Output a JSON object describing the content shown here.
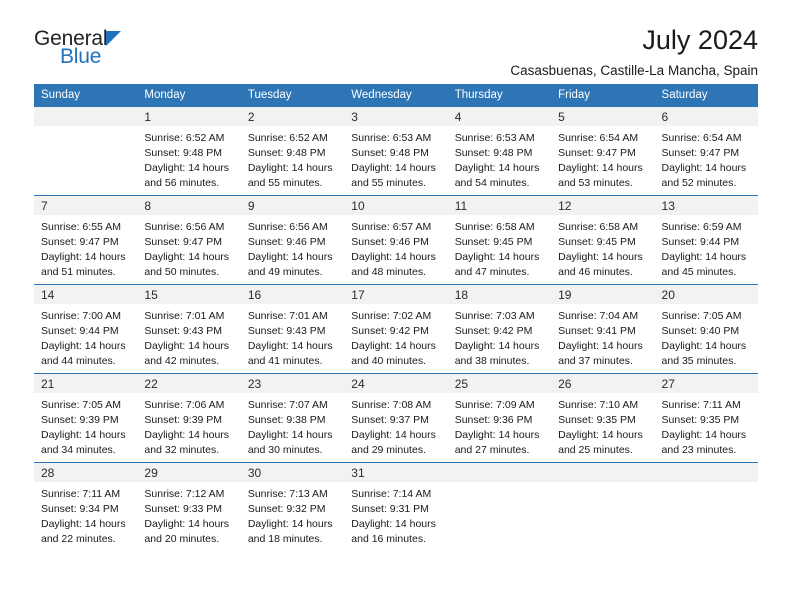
{
  "brand": {
    "name_top": "General",
    "name_bottom": "Blue",
    "accent_color": "#1F72BD",
    "triangle_icon": "brand-triangle-icon"
  },
  "header": {
    "title": "July 2024",
    "subtitle": "Casasbuenas, Castille-La Mancha, Spain"
  },
  "theme": {
    "header_bg": "#2E75B6",
    "daynum_bg": "#F2F2F2",
    "row_border": "#2E75B6"
  },
  "calendar": {
    "weekday_headers": [
      "Sunday",
      "Monday",
      "Tuesday",
      "Wednesday",
      "Thursday",
      "Friday",
      "Saturday"
    ],
    "labels": {
      "sunrise_prefix": "Sunrise:",
      "sunset_prefix": "Sunset:",
      "daylight_prefix": "Daylight:"
    },
    "weeks": [
      [
        {
          "day": ""
        },
        {
          "day": "1",
          "sunrise": "Sunrise: 6:52 AM",
          "sunset": "Sunset: 9:48 PM",
          "daylight_line1": "Daylight: 14 hours",
          "daylight_line2": "and 56 minutes."
        },
        {
          "day": "2",
          "sunrise": "Sunrise: 6:52 AM",
          "sunset": "Sunset: 9:48 PM",
          "daylight_line1": "Daylight: 14 hours",
          "daylight_line2": "and 55 minutes."
        },
        {
          "day": "3",
          "sunrise": "Sunrise: 6:53 AM",
          "sunset": "Sunset: 9:48 PM",
          "daylight_line1": "Daylight: 14 hours",
          "daylight_line2": "and 55 minutes."
        },
        {
          "day": "4",
          "sunrise": "Sunrise: 6:53 AM",
          "sunset": "Sunset: 9:48 PM",
          "daylight_line1": "Daylight: 14 hours",
          "daylight_line2": "and 54 minutes."
        },
        {
          "day": "5",
          "sunrise": "Sunrise: 6:54 AM",
          "sunset": "Sunset: 9:47 PM",
          "daylight_line1": "Daylight: 14 hours",
          "daylight_line2": "and 53 minutes."
        },
        {
          "day": "6",
          "sunrise": "Sunrise: 6:54 AM",
          "sunset": "Sunset: 9:47 PM",
          "daylight_line1": "Daylight: 14 hours",
          "daylight_line2": "and 52 minutes."
        }
      ],
      [
        {
          "day": "7",
          "sunrise": "Sunrise: 6:55 AM",
          "sunset": "Sunset: 9:47 PM",
          "daylight_line1": "Daylight: 14 hours",
          "daylight_line2": "and 51 minutes."
        },
        {
          "day": "8",
          "sunrise": "Sunrise: 6:56 AM",
          "sunset": "Sunset: 9:47 PM",
          "daylight_line1": "Daylight: 14 hours",
          "daylight_line2": "and 50 minutes."
        },
        {
          "day": "9",
          "sunrise": "Sunrise: 6:56 AM",
          "sunset": "Sunset: 9:46 PM",
          "daylight_line1": "Daylight: 14 hours",
          "daylight_line2": "and 49 minutes."
        },
        {
          "day": "10",
          "sunrise": "Sunrise: 6:57 AM",
          "sunset": "Sunset: 9:46 PM",
          "daylight_line1": "Daylight: 14 hours",
          "daylight_line2": "and 48 minutes."
        },
        {
          "day": "11",
          "sunrise": "Sunrise: 6:58 AM",
          "sunset": "Sunset: 9:45 PM",
          "daylight_line1": "Daylight: 14 hours",
          "daylight_line2": "and 47 minutes."
        },
        {
          "day": "12",
          "sunrise": "Sunrise: 6:58 AM",
          "sunset": "Sunset: 9:45 PM",
          "daylight_line1": "Daylight: 14 hours",
          "daylight_line2": "and 46 minutes."
        },
        {
          "day": "13",
          "sunrise": "Sunrise: 6:59 AM",
          "sunset": "Sunset: 9:44 PM",
          "daylight_line1": "Daylight: 14 hours",
          "daylight_line2": "and 45 minutes."
        }
      ],
      [
        {
          "day": "14",
          "sunrise": "Sunrise: 7:00 AM",
          "sunset": "Sunset: 9:44 PM",
          "daylight_line1": "Daylight: 14 hours",
          "daylight_line2": "and 44 minutes."
        },
        {
          "day": "15",
          "sunrise": "Sunrise: 7:01 AM",
          "sunset": "Sunset: 9:43 PM",
          "daylight_line1": "Daylight: 14 hours",
          "daylight_line2": "and 42 minutes."
        },
        {
          "day": "16",
          "sunrise": "Sunrise: 7:01 AM",
          "sunset": "Sunset: 9:43 PM",
          "daylight_line1": "Daylight: 14 hours",
          "daylight_line2": "and 41 minutes."
        },
        {
          "day": "17",
          "sunrise": "Sunrise: 7:02 AM",
          "sunset": "Sunset: 9:42 PM",
          "daylight_line1": "Daylight: 14 hours",
          "daylight_line2": "and 40 minutes."
        },
        {
          "day": "18",
          "sunrise": "Sunrise: 7:03 AM",
          "sunset": "Sunset: 9:42 PM",
          "daylight_line1": "Daylight: 14 hours",
          "daylight_line2": "and 38 minutes."
        },
        {
          "day": "19",
          "sunrise": "Sunrise: 7:04 AM",
          "sunset": "Sunset: 9:41 PM",
          "daylight_line1": "Daylight: 14 hours",
          "daylight_line2": "and 37 minutes."
        },
        {
          "day": "20",
          "sunrise": "Sunrise: 7:05 AM",
          "sunset": "Sunset: 9:40 PM",
          "daylight_line1": "Daylight: 14 hours",
          "daylight_line2": "and 35 minutes."
        }
      ],
      [
        {
          "day": "21",
          "sunrise": "Sunrise: 7:05 AM",
          "sunset": "Sunset: 9:39 PM",
          "daylight_line1": "Daylight: 14 hours",
          "daylight_line2": "and 34 minutes."
        },
        {
          "day": "22",
          "sunrise": "Sunrise: 7:06 AM",
          "sunset": "Sunset: 9:39 PM",
          "daylight_line1": "Daylight: 14 hours",
          "daylight_line2": "and 32 minutes."
        },
        {
          "day": "23",
          "sunrise": "Sunrise: 7:07 AM",
          "sunset": "Sunset: 9:38 PM",
          "daylight_line1": "Daylight: 14 hours",
          "daylight_line2": "and 30 minutes."
        },
        {
          "day": "24",
          "sunrise": "Sunrise: 7:08 AM",
          "sunset": "Sunset: 9:37 PM",
          "daylight_line1": "Daylight: 14 hours",
          "daylight_line2": "and 29 minutes."
        },
        {
          "day": "25",
          "sunrise": "Sunrise: 7:09 AM",
          "sunset": "Sunset: 9:36 PM",
          "daylight_line1": "Daylight: 14 hours",
          "daylight_line2": "and 27 minutes."
        },
        {
          "day": "26",
          "sunrise": "Sunrise: 7:10 AM",
          "sunset": "Sunset: 9:35 PM",
          "daylight_line1": "Daylight: 14 hours",
          "daylight_line2": "and 25 minutes."
        },
        {
          "day": "27",
          "sunrise": "Sunrise: 7:11 AM",
          "sunset": "Sunset: 9:35 PM",
          "daylight_line1": "Daylight: 14 hours",
          "daylight_line2": "and 23 minutes."
        }
      ],
      [
        {
          "day": "28",
          "sunrise": "Sunrise: 7:11 AM",
          "sunset": "Sunset: 9:34 PM",
          "daylight_line1": "Daylight: 14 hours",
          "daylight_line2": "and 22 minutes."
        },
        {
          "day": "29",
          "sunrise": "Sunrise: 7:12 AM",
          "sunset": "Sunset: 9:33 PM",
          "daylight_line1": "Daylight: 14 hours",
          "daylight_line2": "and 20 minutes."
        },
        {
          "day": "30",
          "sunrise": "Sunrise: 7:13 AM",
          "sunset": "Sunset: 9:32 PM",
          "daylight_line1": "Daylight: 14 hours",
          "daylight_line2": "and 18 minutes."
        },
        {
          "day": "31",
          "sunrise": "Sunrise: 7:14 AM",
          "sunset": "Sunset: 9:31 PM",
          "daylight_line1": "Daylight: 14 hours",
          "daylight_line2": "and 16 minutes."
        },
        {
          "day": ""
        },
        {
          "day": ""
        },
        {
          "day": ""
        }
      ]
    ]
  }
}
